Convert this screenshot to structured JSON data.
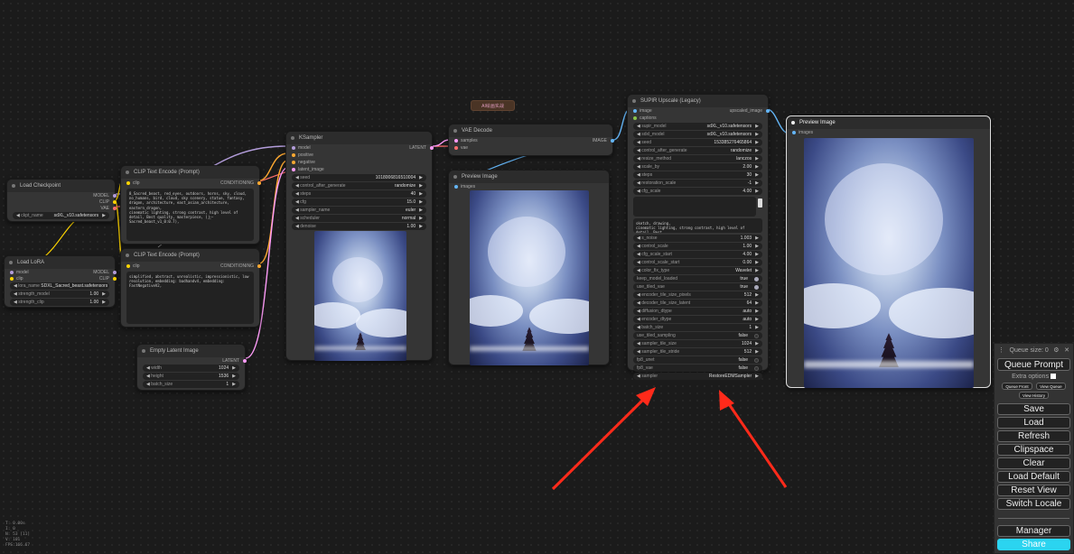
{
  "group_label": "AI绘画实战",
  "nodes": {
    "load_checkpoint": {
      "title": "Load Checkpoint",
      "outputs": [
        "MODEL",
        "CLIP",
        "VAE"
      ],
      "widgets": [
        {
          "name": "ckpt_name",
          "value": "sdXL_v10.safetensors"
        }
      ]
    },
    "load_lora": {
      "title": "Load LoRA",
      "inputs": [
        "model",
        "clip"
      ],
      "outputs": [
        "MODEL",
        "CLIP"
      ],
      "widgets": [
        {
          "name": "lora_name",
          "value": "SDXL_Sacred_beast.safetensors"
        },
        {
          "name": "strength_model",
          "value": "1.00"
        },
        {
          "name": "strength_clip",
          "value": "1.00"
        }
      ]
    },
    "clip_pos": {
      "title": "CLIP Text Encode (Prompt)",
      "input": "clip",
      "output": "CONDITIONING",
      "text": "8_Sacred_beast, red_eyes, outdoors, horns, sky, cloud, no_humans, bird, cloud, sky scenery, statue, fantasy, dragon, architecture, east_asian_architecture, eastern_dragon,\ncinematic lighting, strong contrast, high level of detail, Best quality, masterpiece, (上—Sacred_beast_v1_0:0.7),"
    },
    "clip_neg": {
      "title": "CLIP Text Encode (Prompt)",
      "input": "clip",
      "output": "CONDITIONING",
      "text": "simplified, abstract, unrealistic, impressionistic, low resolution, embedding: badhandv4, embedding: FastNegativeV2,"
    },
    "empty_latent": {
      "title": "Empty Latent Image",
      "output": "LATENT",
      "widgets": [
        {
          "name": "width",
          "value": "1024"
        },
        {
          "name": "height",
          "value": "1536"
        },
        {
          "name": "batch_size",
          "value": "1"
        }
      ]
    },
    "ksampler": {
      "title": "KSampler",
      "inputs": [
        "model",
        "positive",
        "negative",
        "latent_image"
      ],
      "output": "LATENT",
      "widgets": [
        {
          "name": "seed",
          "value": "1018006816510004"
        },
        {
          "name": "control_after_generate",
          "value": "randomize"
        },
        {
          "name": "steps",
          "value": "40"
        },
        {
          "name": "cfg",
          "value": "15.0"
        },
        {
          "name": "sampler_name",
          "value": "euler"
        },
        {
          "name": "scheduler",
          "value": "normal"
        },
        {
          "name": "denoise",
          "value": "1.00"
        }
      ]
    },
    "vae_decode": {
      "title": "VAE Decode",
      "inputs": [
        "samples",
        "vae"
      ],
      "output": "IMAGE"
    },
    "preview1": {
      "title": "Preview Image",
      "input": "images"
    },
    "supir": {
      "title": "SUPIR Upscale (Legacy)",
      "inputs": [
        "image",
        "captions"
      ],
      "output": "upscaled_image",
      "widgets_a": [
        {
          "name": "supir_model",
          "value": "sdXL_v10.safetensors"
        },
        {
          "name": "sdxl_model",
          "value": "sdXL_v10.safetensors"
        },
        {
          "name": "seed",
          "value": "153385276465864"
        },
        {
          "name": "control_after_generate",
          "value": "randomize"
        },
        {
          "name": "resize_method",
          "value": "lanczos"
        },
        {
          "name": "scale_by",
          "value": "2.00"
        },
        {
          "name": "steps",
          "value": "30"
        },
        {
          "name": "restoration_scale",
          "value": "-1"
        },
        {
          "name": "cfg_scale",
          "value": "4.00"
        }
      ],
      "text_a": "",
      "text_b": "sketch, drawing,\ncinematic lighting, strong contrast, high level of detail, Best\nsimplified, abstract, unrealistic, impressionistic, low resolution,",
      "widgets_b": [
        {
          "name": "s_noise",
          "value": "1.003",
          "type": "num"
        },
        {
          "name": "control_scale",
          "value": "1.00",
          "type": "num"
        },
        {
          "name": "cfg_scale_start",
          "value": "4.00",
          "type": "num"
        },
        {
          "name": "control_scale_start",
          "value": "0.00",
          "type": "num"
        },
        {
          "name": "color_fix_type",
          "value": "Wavelet",
          "type": "num"
        },
        {
          "name": "keep_model_loaded",
          "value": "true",
          "type": "toggle_on"
        },
        {
          "name": "use_tiled_vae",
          "value": "true",
          "type": "toggle_on"
        },
        {
          "name": "encoder_tile_size_pixels",
          "value": "512",
          "type": "num"
        },
        {
          "name": "decoder_tile_size_latent",
          "value": "64",
          "type": "num"
        },
        {
          "name": "diffusion_dtype",
          "value": "auto",
          "type": "num"
        },
        {
          "name": "encoder_dtype",
          "value": "auto",
          "type": "num"
        },
        {
          "name": "batch_size",
          "value": "1",
          "type": "num"
        },
        {
          "name": "use_tiled_sampling",
          "value": "false",
          "type": "toggle_off"
        },
        {
          "name": "sampler_tile_size",
          "value": "1024",
          "type": "num"
        },
        {
          "name": "sampler_tile_stride",
          "value": "512",
          "type": "num"
        },
        {
          "name": "fp8_unet",
          "value": "false",
          "type": "toggle_off"
        },
        {
          "name": "fp8_vae",
          "value": "false",
          "type": "toggle_off"
        },
        {
          "name": "sampler",
          "value": "RestoreEDMSampler",
          "type": "num"
        }
      ]
    },
    "preview2": {
      "title": "Preview Image",
      "input": "images"
    }
  },
  "queue_panel": {
    "queue_size": "Queue size: 0",
    "queue_prompt": "Queue Prompt",
    "extra_options": "Extra options",
    "queue_front": "Queue Front",
    "view_queue": "View Queue",
    "view_history": "View History",
    "save": "Save",
    "load": "Load",
    "refresh": "Refresh",
    "clipspace": "Clipspace",
    "clear": "Clear",
    "load_default": "Load Default",
    "reset_view": "Reset View",
    "switch_locale": "Switch Locale",
    "manager": "Manager",
    "share": "Share"
  },
  "stats": [
    "T: 0.00s",
    "I: 0",
    "N: 53 [11]",
    "V: 101",
    "FPS:166.67"
  ],
  "colors": {
    "model": "#b39ddb",
    "clip": "#ffd500",
    "vae": "#ff6e6e",
    "conditioning": "#ffa931",
    "latent": "#ff9cf9",
    "image": "#64b5f6",
    "arrow": "#ff2a1a"
  }
}
